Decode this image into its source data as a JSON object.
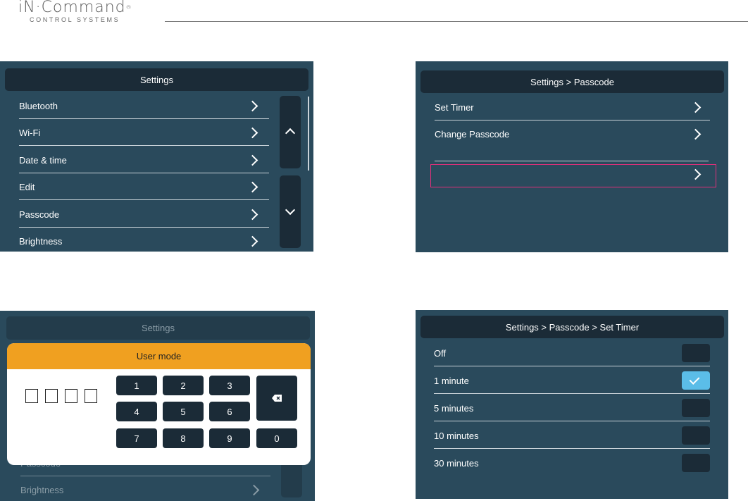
{
  "brand": {
    "name": "iN·Command",
    "reg": "®",
    "tagline": "CONTROL SYSTEMS"
  },
  "panel1": {
    "title": "Settings",
    "items": [
      {
        "label": "Bluetooth"
      },
      {
        "label": "Wi-Fi"
      },
      {
        "label": "Date & time"
      },
      {
        "label": "Edit"
      },
      {
        "label": "Passcode"
      },
      {
        "label": "Brightness"
      }
    ]
  },
  "panel2": {
    "title": "Settings > Passcode",
    "items": [
      {
        "label": "Set Timer"
      },
      {
        "label": "Change Passcode"
      }
    ]
  },
  "panel3": {
    "bg_title": "Settings",
    "bg_items": [
      {
        "label": "Passcode"
      },
      {
        "label": "Brightness"
      }
    ],
    "modal_title": "User mode",
    "keys": [
      "1",
      "2",
      "3",
      "4",
      "5",
      "6",
      "7",
      "8",
      "9",
      "0"
    ]
  },
  "panel4": {
    "title": "Settings > Passcode > Set Timer",
    "options": [
      {
        "label": "Off",
        "selected": false
      },
      {
        "label": "1 minute",
        "selected": true
      },
      {
        "label": "5 minutes",
        "selected": false
      },
      {
        "label": "10 minutes",
        "selected": false
      },
      {
        "label": "30 minutes",
        "selected": false
      }
    ]
  },
  "colors": {
    "panel": "#2a4a5c",
    "header": "#1b2b37",
    "accent": "#f0a020",
    "checked": "#5bbde8",
    "highlight": "#e0307a"
  }
}
